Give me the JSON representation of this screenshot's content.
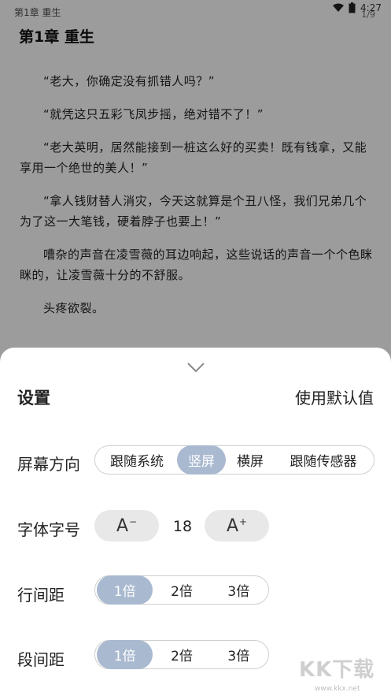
{
  "status": {
    "left_text": "第1章 重生",
    "time": "4:27",
    "page_indicator": "1/9"
  },
  "reader": {
    "chapter_title": "第1章 重生",
    "paragraphs": [
      "“老大，你确定没有抓错人吗？”",
      "“就凭这只五彩飞凤步摇，绝对错不了！”",
      "“老大英明，居然能接到一桩这么好的买卖！既有钱拿，又能享用一个绝世的美人！”",
      "“拿人钱财替人消灾，今天这就算是个丑八怪，我们兄弟几个为了这一大笔钱，硬着脖子也要上！”",
      "嘈杂的声音在凌雪薇的耳边响起，这些说话的声音一个个色眯眯的，让凌雪薇十分的不舒服。",
      "头疼欲裂。"
    ]
  },
  "settings": {
    "title": "设置",
    "reset_label": "使用默认值",
    "orientation": {
      "label": "屏幕方向",
      "options": [
        "跟随系统",
        "竖屏",
        "横屏",
        "跟随传感器"
      ],
      "selected": "竖屏"
    },
    "font_size": {
      "label": "字体字号",
      "decrease_label": "A",
      "decrease_mark": "−",
      "increase_label": "A",
      "increase_mark": "+",
      "value": "18"
    },
    "line_spacing": {
      "label": "行间距",
      "options": [
        "1倍",
        "2倍",
        "3倍"
      ],
      "selected": "1倍"
    },
    "para_spacing": {
      "label": "段间距",
      "options": [
        "1倍",
        "2倍",
        "3倍"
      ],
      "selected": "1倍"
    }
  },
  "watermark": {
    "text": "KK下载",
    "url": "www.kkx.net"
  },
  "colors": {
    "accent_selected": "#a9b9d0",
    "overlay": "rgba(0,0,0,0.36)"
  }
}
